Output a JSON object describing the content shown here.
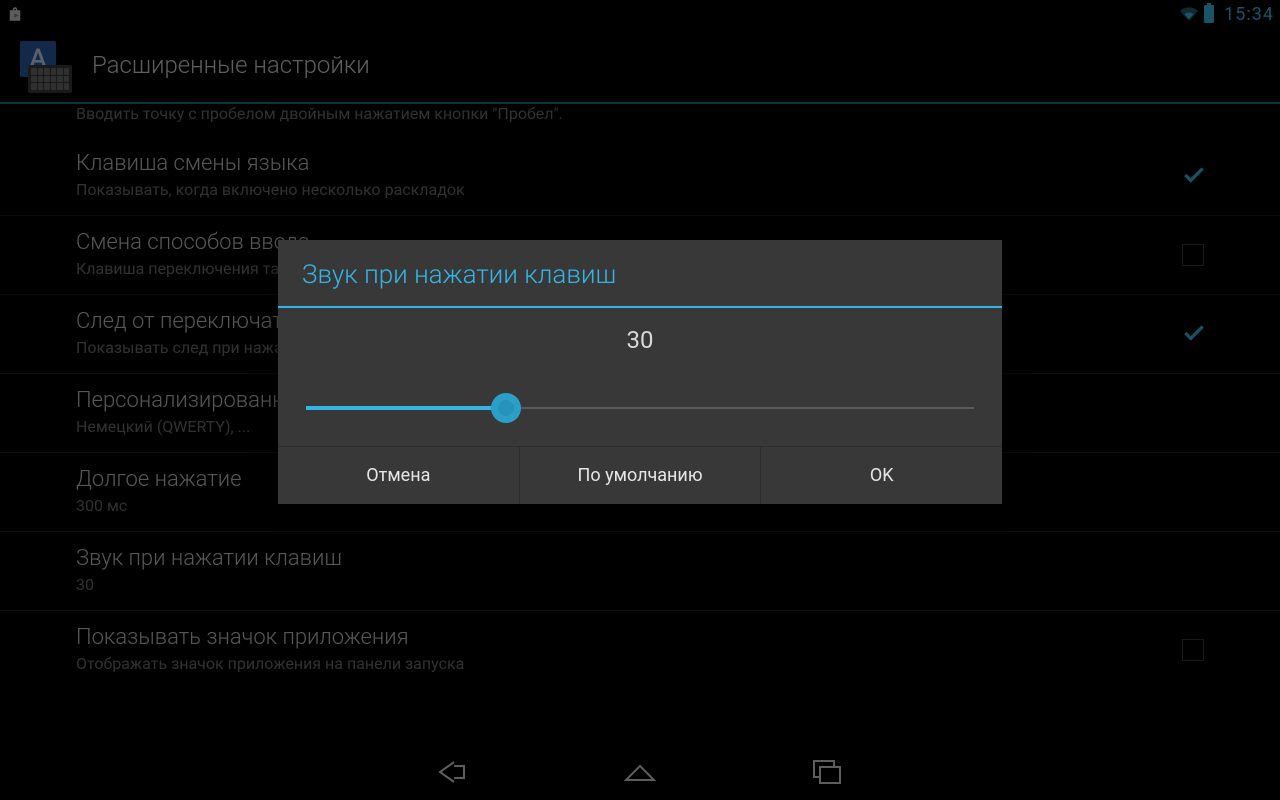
{
  "status": {
    "time": "15:34"
  },
  "header": {
    "title": "Расширенные настройки"
  },
  "list": {
    "cutoff_sub": "Вводить точку с пробелом двойным нажатием кнопки \"Пробел\".",
    "items": [
      {
        "title": "Клавиша смены языка",
        "sub": "Показывать, когда включено несколько раскладок",
        "checkbox": true,
        "checked": true
      },
      {
        "title": "Смена способов ввода",
        "sub": "Клавиша переключения также служит для смены других способов ввода",
        "checkbox": true,
        "checked": false
      },
      {
        "title": "След от переключателя",
        "sub": "Показывать след при нажатии переключателя",
        "checkbox": true,
        "checked": true
      },
      {
        "title": "Персонализированные словари",
        "sub": "Немецкий (QWERTY), ...",
        "checkbox": false
      },
      {
        "title": "Долгое нажатие",
        "sub": "300 мс",
        "checkbox": false
      },
      {
        "title": "Звук при нажатии клавиш",
        "sub": "30",
        "checkbox": false
      },
      {
        "title": "Показывать значок приложения",
        "sub": "Отображать значок приложения на панели запуска",
        "checkbox": true,
        "checked": false
      }
    ]
  },
  "dialog": {
    "title": "Звук при нажатии клавиш",
    "value": "30",
    "slider_percent": 30,
    "buttons": {
      "cancel": "Отмена",
      "default": "По умолчанию",
      "ok": "OK"
    }
  }
}
